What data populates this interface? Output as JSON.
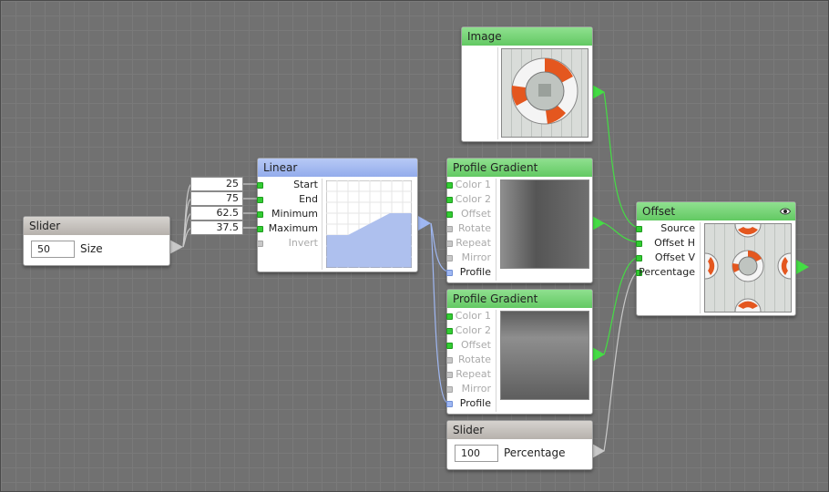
{
  "canvas": {
    "background": "#717171",
    "grid": "#7a7a7a"
  },
  "nodes": {
    "slider_size": {
      "title": "Slider",
      "value": "50",
      "label": "Size"
    },
    "constants": [
      "25",
      "75",
      "62.5",
      "37.5"
    ],
    "linear": {
      "title": "Linear",
      "inputs": [
        "Start",
        "End",
        "Minimum",
        "Maximum",
        "Invert"
      ]
    },
    "image": {
      "title": "Image",
      "thumbnail_icon": "lifebuoy-image"
    },
    "profile_gradient_1": {
      "title": "Profile Gradient",
      "inputs": [
        "Color 1",
        "Color 2",
        "Offset",
        "Rotate",
        "Repeat",
        "Mirror",
        "Profile"
      ]
    },
    "profile_gradient_2": {
      "title": "Profile Gradient",
      "inputs": [
        "Color 1",
        "Color 2",
        "Offset",
        "Rotate",
        "Repeat",
        "Mirror",
        "Profile"
      ]
    },
    "offset": {
      "title": "Offset",
      "inputs": [
        "Source",
        "Offset H",
        "Offset V",
        "Percentage"
      ],
      "visibility_icon": "eye-icon"
    },
    "slider_percentage": {
      "title": "Slider",
      "value": "100",
      "label": "Percentage"
    }
  },
  "colors": {
    "wire_green": "#44dd44",
    "wire_blue": "#9fb7f2",
    "wire_gray": "#c8c8c8",
    "title_green": "#78d678",
    "title_blue": "#a6bbf0",
    "title_gray": "#c6c2bd"
  }
}
